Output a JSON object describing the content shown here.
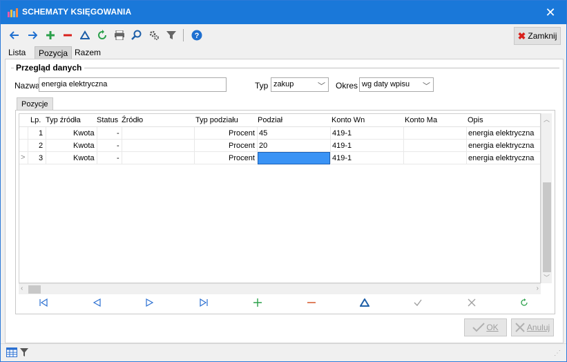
{
  "window": {
    "title": "SCHEMATY KSIĘGOWANIA"
  },
  "toolbar": {
    "buttons": [
      {
        "name": "back-arrow-icon",
        "glyph": "←"
      },
      {
        "name": "forward-arrow-icon",
        "glyph": "→"
      },
      {
        "name": "add-icon",
        "glyph": "+"
      },
      {
        "name": "remove-icon",
        "glyph": "−"
      },
      {
        "name": "delta-icon",
        "glyph": "Δ"
      },
      {
        "name": "refresh-icon",
        "glyph": "↻"
      },
      {
        "name": "print-icon",
        "glyph": "⎙"
      },
      {
        "name": "search-icon",
        "glyph": "⚲"
      },
      {
        "name": "settings-icon",
        "glyph": "⚙"
      },
      {
        "name": "filter-icon",
        "glyph": "▼"
      },
      {
        "name": "help-icon",
        "glyph": "?"
      }
    ],
    "close_label": "Zamknij"
  },
  "tabs": [
    "Lista",
    "Pozycja",
    "Razem"
  ],
  "active_tab": "Pozycja",
  "form": {
    "group_title": "Przegląd danych",
    "nazwa_label": "Nazwa",
    "nazwa_value": "energia elektryczna",
    "typ_label": "Typ",
    "typ_value": "zakup",
    "okres_label": "Okres",
    "okres_value": "wg daty wpisu"
  },
  "subtab": "Pozycje",
  "grid": {
    "columns": [
      "Lp.",
      "Typ źródła",
      "Status",
      "Źródło",
      "Typ podziału",
      "Podział",
      "Konto Wn",
      "Konto Ma",
      "Opis"
    ],
    "rows": [
      {
        "lp": "1",
        "typ_zrodla": "Kwota",
        "status": "-",
        "zrodlo": "",
        "typ_podzialu": "Procent",
        "podzial": "45",
        "konto_wn": "419-1",
        "konto_ma": "",
        "opis": "energia elektryczna"
      },
      {
        "lp": "2",
        "typ_zrodla": "Kwota",
        "status": "-",
        "zrodlo": "",
        "typ_podzialu": "Procent",
        "podzial": "20",
        "konto_wn": "419-1",
        "konto_ma": "",
        "opis": "energia elektryczna"
      },
      {
        "lp": "3",
        "typ_zrodla": "Kwota",
        "status": "-",
        "zrodlo": "",
        "typ_podzialu": "Procent",
        "podzial": "",
        "konto_wn": "419-1",
        "konto_ma": "",
        "opis": "energia elektryczna"
      }
    ],
    "current_row_marker": ">"
  },
  "navigator": [
    {
      "name": "first-record-icon",
      "glyph": "⏮",
      "color": "#2a6fd1"
    },
    {
      "name": "prev-record-icon",
      "glyph": "◁",
      "color": "#2a6fd1"
    },
    {
      "name": "next-record-icon",
      "glyph": "▷",
      "color": "#2a6fd1"
    },
    {
      "name": "last-record-icon",
      "glyph": "⏭",
      "color": "#2a6fd1"
    },
    {
      "name": "insert-record-icon",
      "glyph": "+",
      "color": "#2aa04a"
    },
    {
      "name": "delete-record-icon",
      "glyph": "−",
      "color": "#d24a1a"
    },
    {
      "name": "edit-record-icon",
      "glyph": "▲",
      "color": "#1e5fa8"
    },
    {
      "name": "post-record-icon",
      "glyph": "✓",
      "color": "#a0a0a0"
    },
    {
      "name": "cancel-record-icon",
      "glyph": "✕",
      "color": "#a0a0a0"
    },
    {
      "name": "refresh-record-icon",
      "glyph": "↻",
      "color": "#2aa04a"
    }
  ],
  "buttons": {
    "ok": "OK",
    "anuluj": "Anuluj"
  }
}
